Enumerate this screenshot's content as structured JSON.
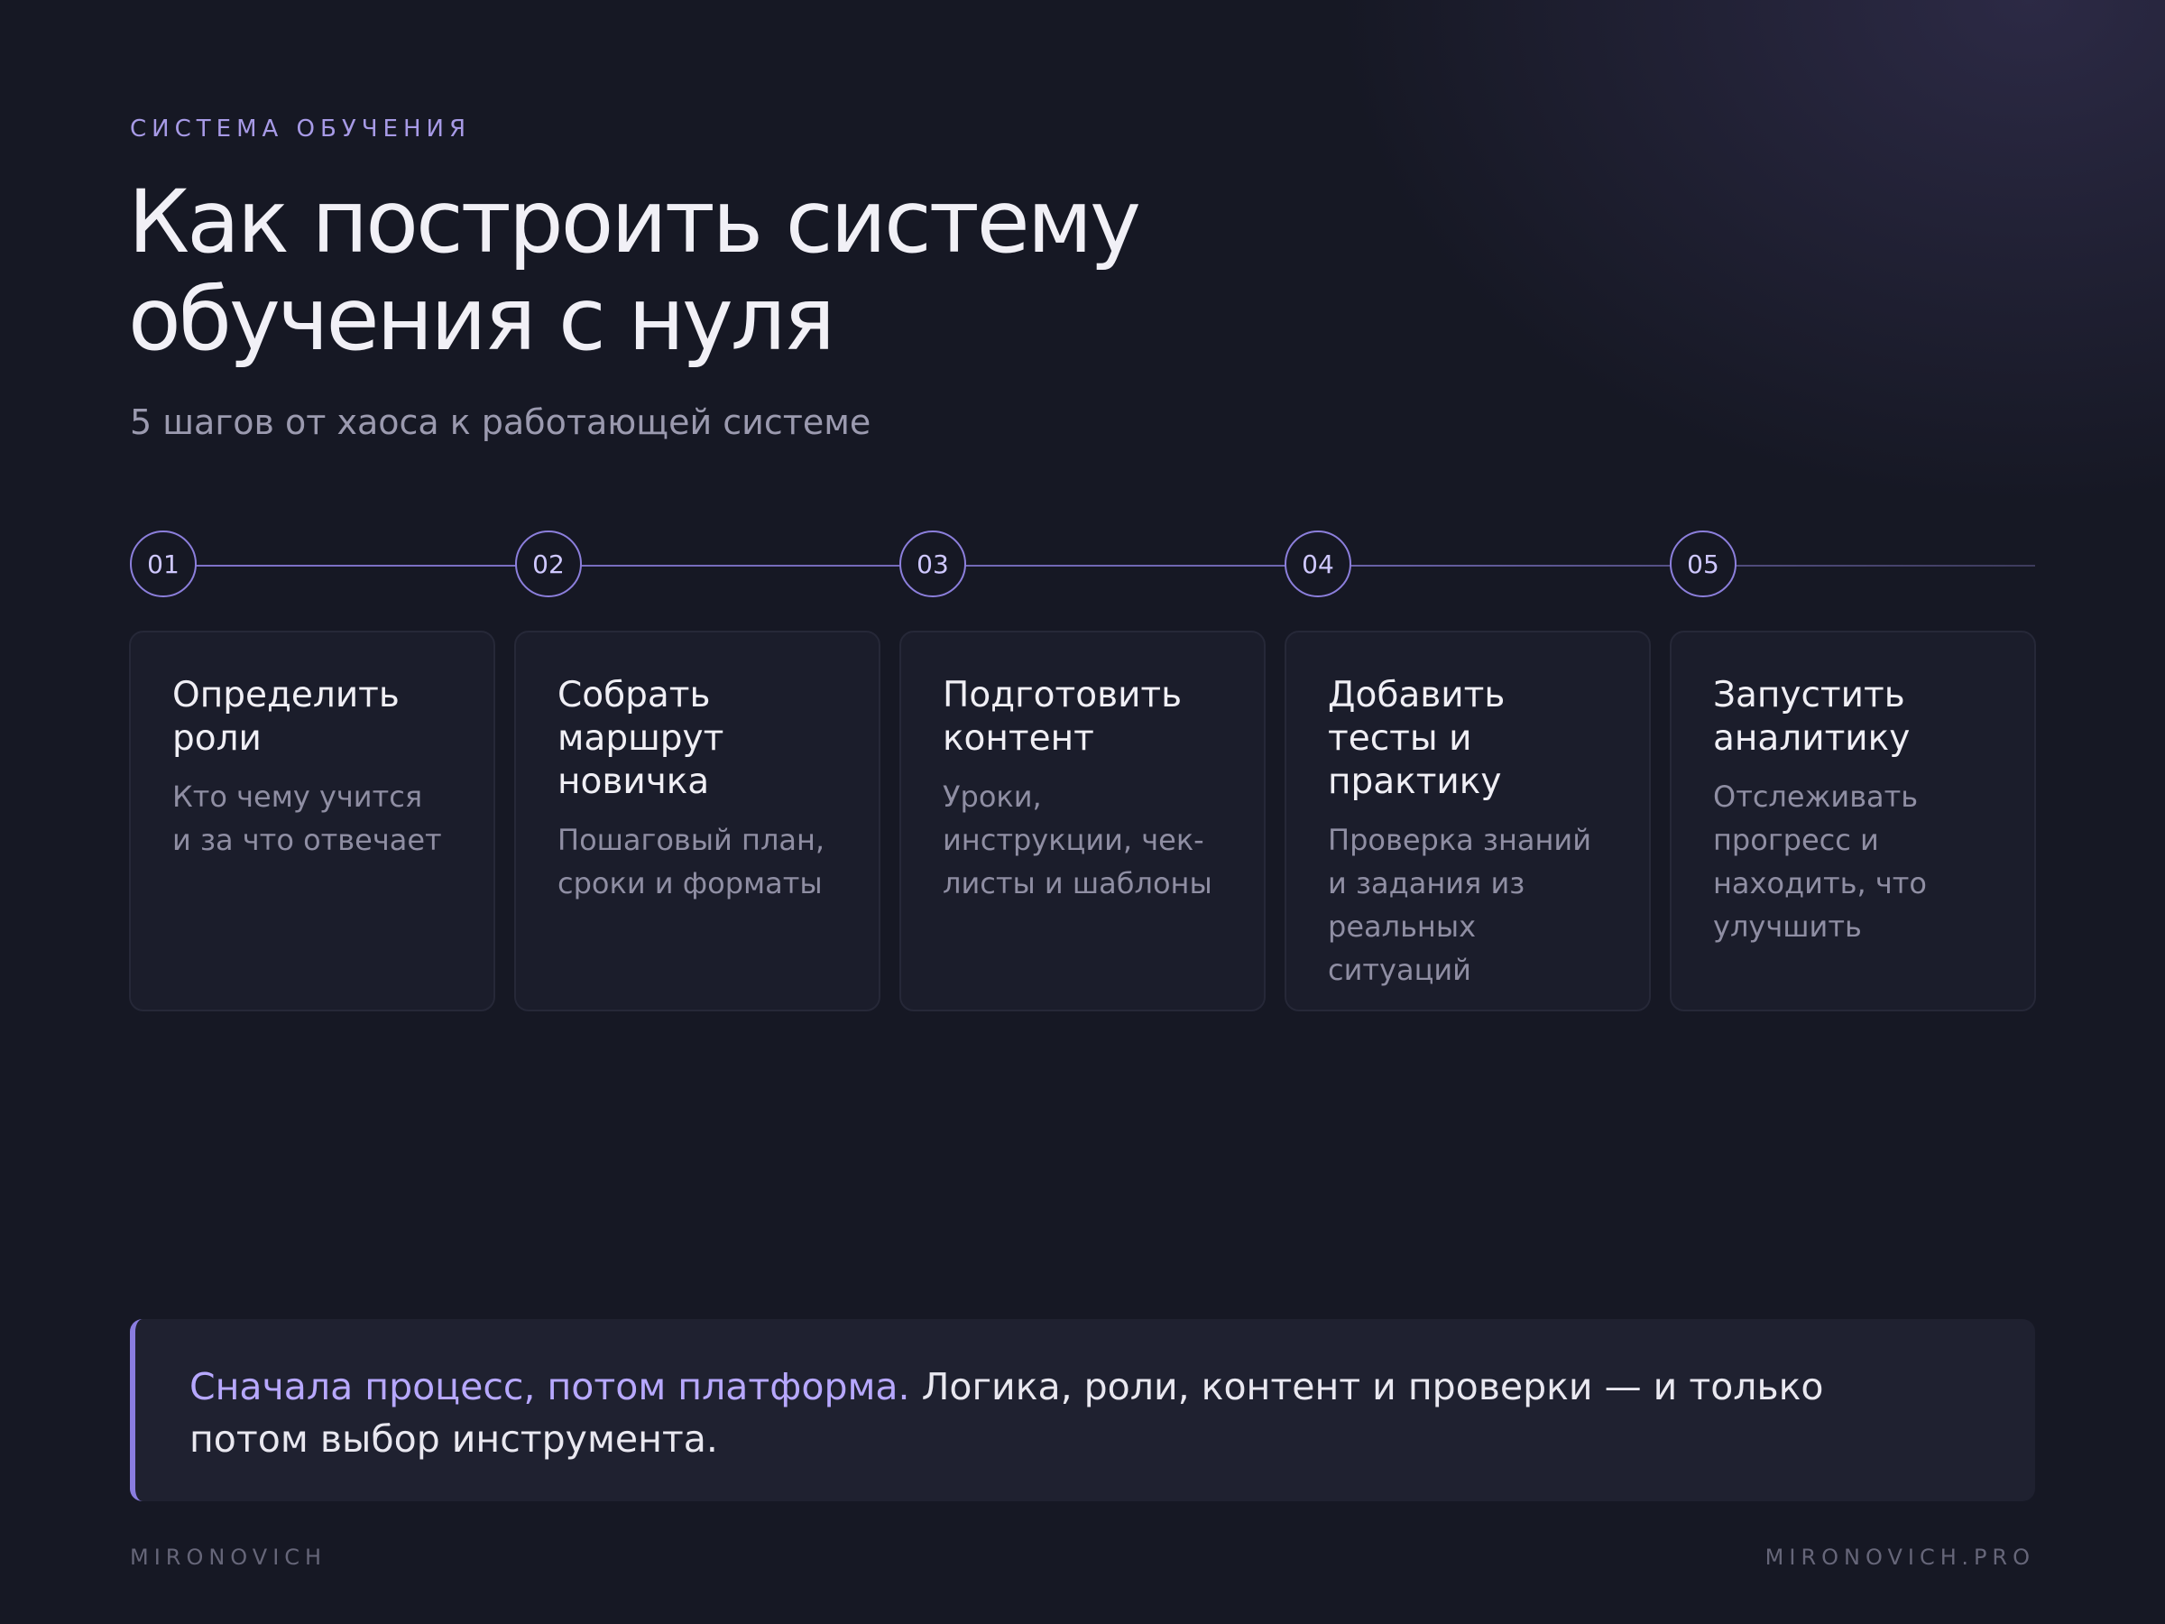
{
  "eyebrow": "Система обучения",
  "title": "Как построить систему обучения с нуля",
  "subtitle": "5 шагов от хаоса к работающей системе",
  "steps": [
    {
      "number": "01",
      "title": "Определить роли",
      "description": "Кто чему учится и за что отвечает"
    },
    {
      "number": "02",
      "title": "Собрать маршрут новичка",
      "description": "Пошаговый план, сроки и форматы"
    },
    {
      "number": "03",
      "title": "Подготовить контент",
      "description": "Уроки, инструкции, чек-листы и шаблоны"
    },
    {
      "number": "04",
      "title": "Добавить тесты и практику",
      "description": "Проверка знаний и задания из реальных ситуаций"
    },
    {
      "number": "05",
      "title": "Запустить аналитику",
      "description": "Отслеживать прогресс и находить, что улучшить"
    }
  ],
  "callout": {
    "highlight": "Сначала процесс, потом платформа.",
    "text": " Логика, роли, контент и проверки — и только потом выбор инструмента."
  },
  "footer": {
    "left": "MIRONOVICH",
    "right": "MIRONOVICH.PRO"
  },
  "colors": {
    "background": "#161824",
    "accent": "#8c7fdc",
    "card": "#1b1d2b",
    "callout_bg": "#1f2130"
  }
}
